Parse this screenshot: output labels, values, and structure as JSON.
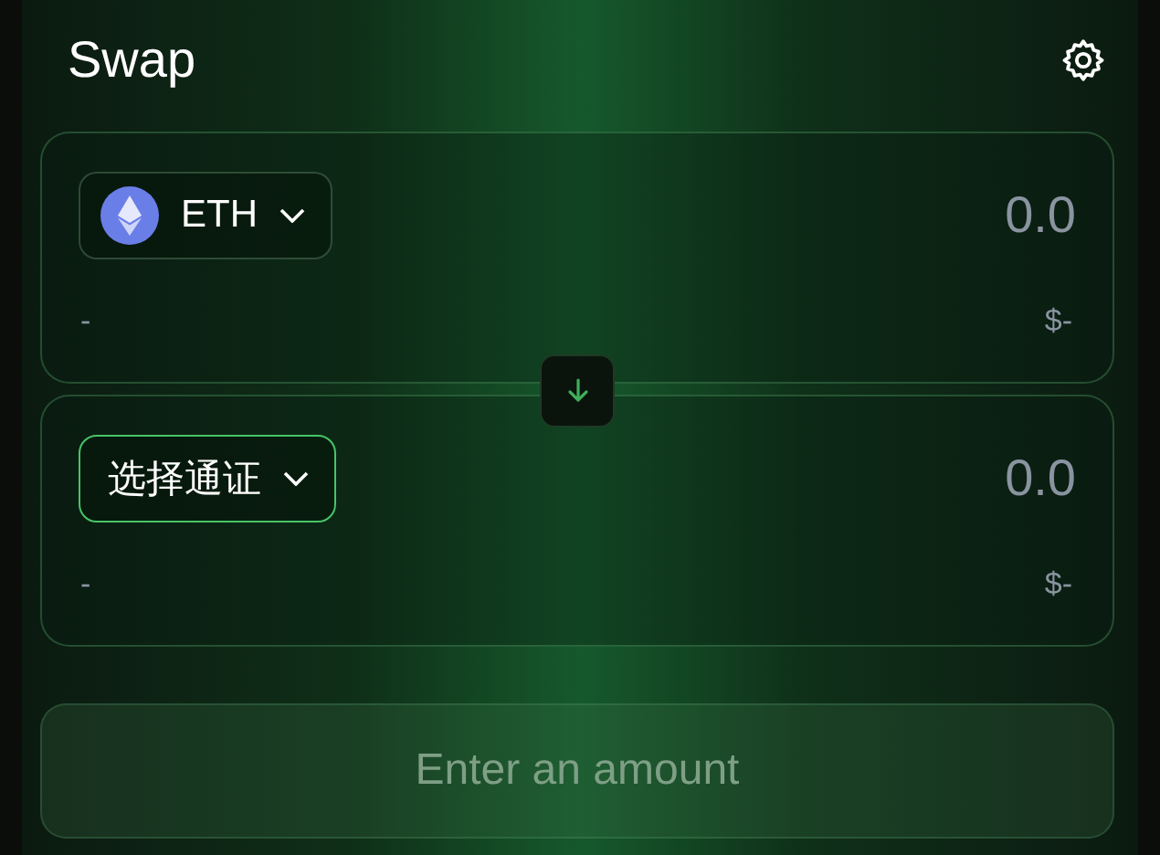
{
  "header": {
    "title": "Swap"
  },
  "panels": [
    {
      "token": {
        "kind": "token",
        "label": "ETH"
      },
      "amount": {
        "placeholder": "0.0"
      },
      "balance": "-",
      "usd": "$-"
    },
    {
      "token": {
        "kind": "prompt",
        "label": "选择通证"
      },
      "amount": {
        "placeholder": "0.0"
      },
      "balance": "-",
      "usd": "$-"
    }
  ],
  "action": {
    "label": "Enter an amount",
    "disabled": true
  }
}
